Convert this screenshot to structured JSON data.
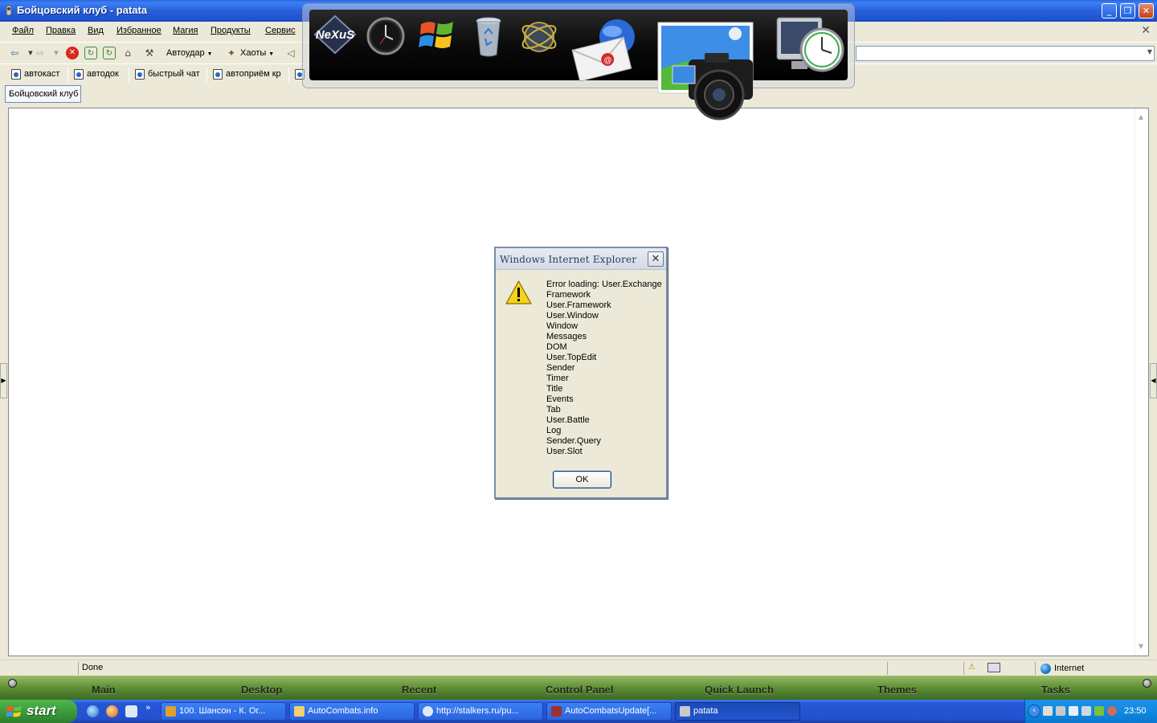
{
  "window": {
    "title": "Бойцовский клуб - patata",
    "minimize": "_",
    "restore": "❐",
    "close": "✕"
  },
  "menu": {
    "items": [
      "Файл",
      "Правка",
      "Вид",
      "Избранное",
      "Магия",
      "Продукты",
      "Сервис"
    ],
    "close_icon": "✕"
  },
  "toolbar": {
    "autoudar_label": "Автоудар",
    "haoty_label": "Хаоты"
  },
  "links": {
    "items": [
      "автокаст",
      "автодок",
      "быстрый чат",
      "автоприём кр"
    ]
  },
  "tabs": {
    "active_label": "Бойцовский клуб"
  },
  "dock": {
    "icons": [
      "nexus-logo",
      "clock",
      "windows-flag",
      "recycle-bin",
      "network-globe",
      "mail-envelope",
      "photo-camera",
      "monitor-clock"
    ],
    "logo_text": "NeXuS"
  },
  "dialog": {
    "title": "Windows Internet Explorer",
    "close_icon": "✕",
    "message": "Error loading: User.Exchange\nFramework\nUser.Framework\nUser.Window\nWindow\nMessages\nDOM\nUser.TopEdit\nSender\nTimer\nTitle\nEvents\nTab\nUser.Battle\nLog\nSender.Query\nUser.Slot",
    "ok_label": "OK",
    "icon": "warning-icon"
  },
  "statusbar": {
    "status_text": "Done",
    "zone_label": "Internet"
  },
  "nexusbar": {
    "items": [
      "Main",
      "Desktop",
      "Recent",
      "Control Panel",
      "Quick Launch",
      "Themes",
      "Tasks"
    ],
    "color": "#5a8a34"
  },
  "taskbar": {
    "start_label": "start",
    "quicklaunch_more": "»",
    "tasks": [
      {
        "label": "100. Шансон - К. Ог..."
      },
      {
        "label": "AutoCombats.info"
      },
      {
        "label": "http://stalkers.ru/pu..."
      },
      {
        "label": "AutoCombatsUpdate[..."
      },
      {
        "label": "patata"
      }
    ],
    "clock": "23:50",
    "tray_chevron": "‹"
  },
  "colors": {
    "titlebar": "#2a5fd8",
    "taskbar": "#2451cf",
    "start_green": "#3b9c3b",
    "chrome": "#ece9d8"
  }
}
